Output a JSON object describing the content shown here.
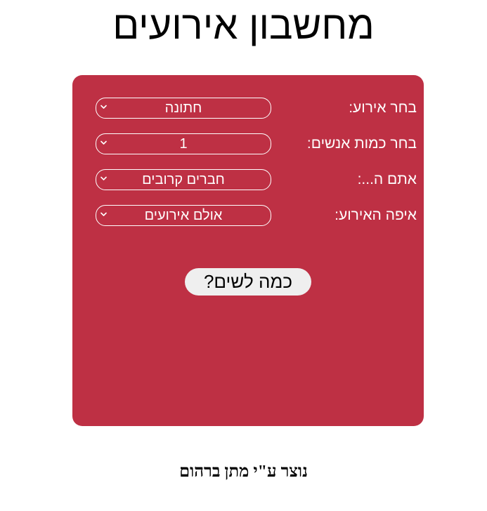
{
  "page": {
    "title": "מחשבון אירועים",
    "footer": "נוצר ע\"י מתן ברהום"
  },
  "form": {
    "fields": [
      {
        "label": "בחר אירוע:",
        "value": "חתונה"
      },
      {
        "label": "בחר כמות אנשים:",
        "value": "1"
      },
      {
        "label": "אתם ה...:",
        "value": "חברים קרובים"
      },
      {
        "label": "איפה האירוע:",
        "value": "אולם אירועים"
      }
    ],
    "submit_label": "כמה לשים?"
  },
  "colors": {
    "card_background": "#be3044",
    "button_background": "#efefef"
  },
  "icons": {
    "dropdown": "chevron-down-icon"
  }
}
